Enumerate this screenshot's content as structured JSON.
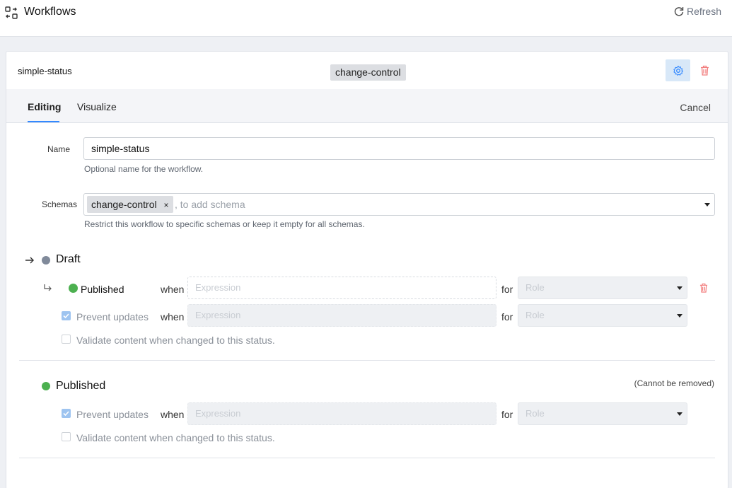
{
  "header": {
    "title": "Workflows",
    "refresh_label": "Refresh"
  },
  "workflow": {
    "name": "simple-status",
    "schema_tag": "change-control"
  },
  "tabs": [
    {
      "label": "Editing"
    },
    {
      "label": "Visualize"
    }
  ],
  "cancel_label": "Cancel",
  "form": {
    "name_label": "Name",
    "name_value": "simple-status",
    "name_hint": "Optional name for the workflow.",
    "schemas_label": "Schemas",
    "schemas_chip": "change-control",
    "schemas_remove": "×",
    "schemas_placeholder": ", to add schema",
    "schemas_hint": "Restrict this workflow to specific schemas or keep it empty for all schemas."
  },
  "statuses": [
    {
      "name": "Draft",
      "color": "#808a9a",
      "transition": {
        "target": "Published",
        "target_color": "#4cb050",
        "when": "when",
        "expression_placeholder": "Expression",
        "for": "for",
        "role_placeholder": "Role"
      },
      "prevent_updates": {
        "label": "Prevent updates",
        "checked": true,
        "when": "when",
        "expression_placeholder": "Expression",
        "for": "for",
        "role_placeholder": "Role"
      },
      "validate": {
        "label": "Validate content when changed to this status.",
        "checked": false
      }
    },
    {
      "name": "Published",
      "color": "#4cb050",
      "note": "(Cannot be removed)",
      "prevent_updates": {
        "label": "Prevent updates",
        "checked": true,
        "when": "when",
        "expression_placeholder": "Expression",
        "for": "for",
        "role_placeholder": "Role"
      },
      "validate": {
        "label": "Validate content when changed to this status.",
        "checked": false
      }
    }
  ],
  "colors": {
    "accent": "#3389ff",
    "danger": "#f27d7d",
    "gear_bg": "#d8e8f8"
  }
}
